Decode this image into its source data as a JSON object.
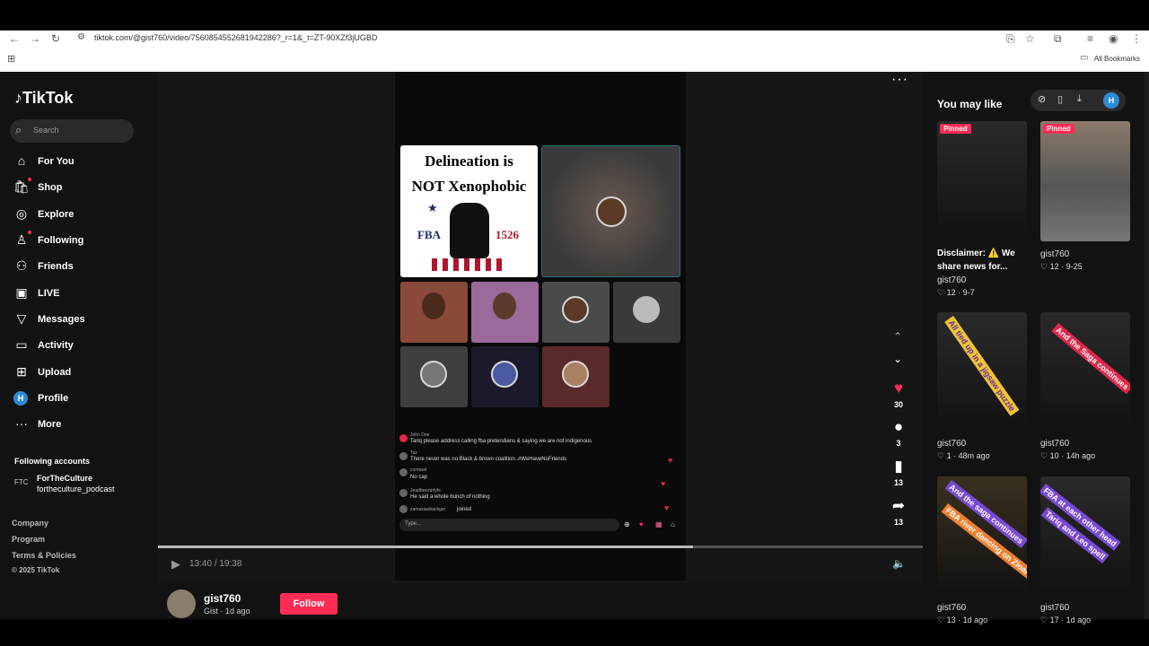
{
  "browser": {
    "url": "tiktok.com/@gist760/video/7560854552681942286?_r=1&_t=ZT-90XZf3jUGBD",
    "bookmarks_label": "All Bookmarks"
  },
  "sidebar": {
    "logo": "TikTok",
    "search_placeholder": "Search",
    "items": [
      {
        "label": "For You",
        "icon": "home-icon"
      },
      {
        "label": "Shop",
        "icon": "shop-icon"
      },
      {
        "label": "Explore",
        "icon": "compass-icon"
      },
      {
        "label": "Following",
        "icon": "following-icon"
      },
      {
        "label": "Friends",
        "icon": "friends-icon"
      },
      {
        "label": "LIVE",
        "icon": "live-icon"
      },
      {
        "label": "Messages",
        "icon": "messages-icon"
      },
      {
        "label": "Activity",
        "icon": "activity-icon"
      },
      {
        "label": "Upload",
        "icon": "upload-icon"
      },
      {
        "label": "Profile",
        "icon": "profile-avatar"
      },
      {
        "label": "More",
        "icon": "more-icon"
      }
    ],
    "profile_initial": "H",
    "following_title": "Following accounts",
    "account": {
      "badge": "FTC",
      "name": "ForTheCulture",
      "handle": "fortheculture_podcast"
    },
    "footer": [
      "Company",
      "Program",
      "Terms & Policies",
      "© 2025 TikTok"
    ]
  },
  "video": {
    "poster_line1": "Delineation is",
    "poster_line2": "NOT Xenophobic",
    "poster_left": "FBA",
    "poster_right": "1526",
    "comments": [
      {
        "name": "John Doe",
        "text": "Tariq please address calling fba pretendians & saying we are not indigenous"
      },
      {
        "name": "Taz",
        "text": "There never was no Black & brown coalition..#WeHaveNoFriends"
      },
      {
        "name": "comewit",
        "text": "No cap"
      },
      {
        "name": "Jeadbeezarlyfe",
        "text": "He said a whole bunch of nothing"
      },
      {
        "name": "zamasiaobackgor",
        "text": "joined"
      }
    ],
    "type_placeholder": "Type...",
    "time": "13:40 / 19:38",
    "progress": 0.7
  },
  "actions": {
    "likes": "30",
    "comments": "3",
    "saves": "13",
    "shares": "13"
  },
  "author": {
    "name": "gist760",
    "sub": "Gist · 1d ago",
    "follow_label": "Follow"
  },
  "you_may_like": {
    "title": "You may like",
    "tools_initial": "H",
    "cards": [
      {
        "pinned": "Pinned",
        "caption": "Disclaimer: ⚠️ We share news for...",
        "author": "gist760",
        "stats": "♡ 12 · 9-7"
      },
      {
        "pinned": "Pinned",
        "caption": "",
        "author": "gist760",
        "stats": "♡ 12 · 9-25"
      },
      {
        "overlay": "All tied up in a jigsaw puzzle",
        "author": "gist760",
        "stats": "♡ 1 · 48m ago"
      },
      {
        "overlay": "And the Saga continues",
        "author": "gist760",
        "stats": "♡ 10 · 14h ago"
      },
      {
        "overlay": "And the saga continues",
        "overlay2": "FBA river dancing on Zioan head",
        "author": "gist760",
        "stats": "♡ 13 · 1d ago"
      },
      {
        "overlay": "FBA at each other head",
        "overlay2": "Tariq and Leo spell",
        "author": "gist760",
        "stats": "♡ 17 · 1d ago"
      }
    ]
  },
  "colors": {
    "accent": "#fe2c55",
    "bg": "#121212",
    "profile": "#2b8cd8"
  }
}
